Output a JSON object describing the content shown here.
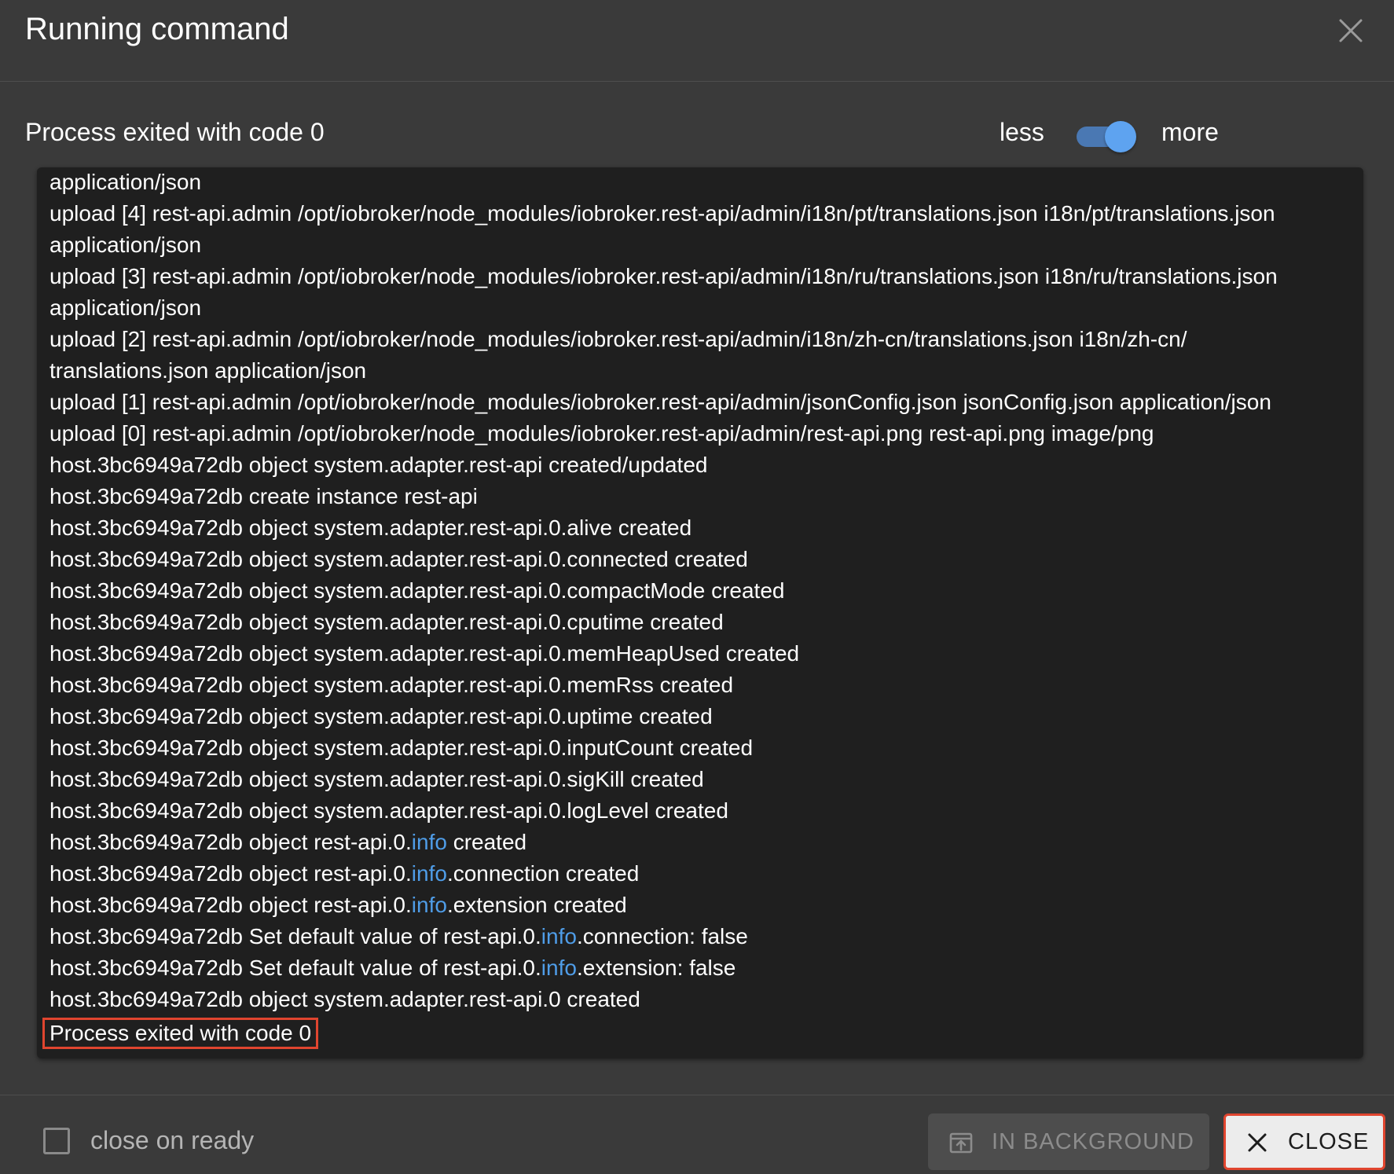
{
  "dialog": {
    "title": "Running command",
    "close_icon": "close-icon"
  },
  "status": {
    "text": "Process exited with code 0"
  },
  "verbosity_toggle": {
    "less_label": "less",
    "more_label": "more",
    "checked": true,
    "accent_color": "#5ea3f0"
  },
  "log": {
    "lines": [
      [
        {
          "t": "application/json"
        }
      ],
      [
        {
          "t": "upload [4] rest-api.admin /opt/iobroker/node_modules/iobroker.rest-api/admin/i18n/pt/translations.json i18n/pt/translations.json"
        }
      ],
      [
        {
          "t": "application/json"
        }
      ],
      [
        {
          "t": "upload [3] rest-api.admin /opt/iobroker/node_modules/iobroker.rest-api/admin/i18n/ru/translations.json i18n/ru/translations.json"
        }
      ],
      [
        {
          "t": "application/json"
        }
      ],
      [
        {
          "t": "upload [2] rest-api.admin /opt/iobroker/node_modules/iobroker.rest-api/admin/i18n/zh-cn/translations.json i18n/zh-cn/"
        }
      ],
      [
        {
          "t": "translations.json application/json"
        }
      ],
      [
        {
          "t": "upload [1] rest-api.admin /opt/iobroker/node_modules/iobroker.rest-api/admin/jsonConfig.json jsonConfig.json application/json"
        }
      ],
      [
        {
          "t": "upload [0] rest-api.admin /opt/iobroker/node_modules/iobroker.rest-api/admin/rest-api.png rest-api.png image/png"
        }
      ],
      [
        {
          "t": "host.3bc6949a72db object system.adapter.rest-api created/updated"
        }
      ],
      [
        {
          "t": "host.3bc6949a72db create instance rest-api"
        }
      ],
      [
        {
          "t": "host.3bc6949a72db object system.adapter.rest-api.0.alive created"
        }
      ],
      [
        {
          "t": "host.3bc6949a72db object system.adapter.rest-api.0.connected created"
        }
      ],
      [
        {
          "t": "host.3bc6949a72db object system.adapter.rest-api.0.compactMode created"
        }
      ],
      [
        {
          "t": "host.3bc6949a72db object system.adapter.rest-api.0.cputime created"
        }
      ],
      [
        {
          "t": "host.3bc6949a72db object system.adapter.rest-api.0.memHeapUsed created"
        }
      ],
      [
        {
          "t": "host.3bc6949a72db object system.adapter.rest-api.0.memRss created"
        }
      ],
      [
        {
          "t": "host.3bc6949a72db object system.adapter.rest-api.0.uptime created"
        }
      ],
      [
        {
          "t": "host.3bc6949a72db object system.adapter.rest-api.0.inputCount created"
        }
      ],
      [
        {
          "t": "host.3bc6949a72db object system.adapter.rest-api.0.sigKill created"
        }
      ],
      [
        {
          "t": "host.3bc6949a72db object system.adapter.rest-api.0.logLevel created"
        }
      ],
      [
        {
          "t": "host.3bc6949a72db object rest-api.0."
        },
        {
          "t": "info",
          "hl": true
        },
        {
          "t": " created"
        }
      ],
      [
        {
          "t": "host.3bc6949a72db object rest-api.0."
        },
        {
          "t": "info",
          "hl": true
        },
        {
          "t": ".connection created"
        }
      ],
      [
        {
          "t": "host.3bc6949a72db object rest-api.0."
        },
        {
          "t": "info",
          "hl": true
        },
        {
          "t": ".extension created"
        }
      ],
      [
        {
          "t": "host.3bc6949a72db Set default value of rest-api.0."
        },
        {
          "t": "info",
          "hl": true
        },
        {
          "t": ".connection: false"
        }
      ],
      [
        {
          "t": "host.3bc6949a72db Set default value of rest-api.0."
        },
        {
          "t": "info",
          "hl": true
        },
        {
          "t": ".extension: false"
        }
      ],
      [
        {
          "t": "host.3bc6949a72db object system.adapter.rest-api.0 created"
        }
      ]
    ],
    "final_line": "Process exited with code 0",
    "highlight_color": "#4f9de8",
    "annotation_color": "#e0452f"
  },
  "footer": {
    "close_on_ready_label": "close on ready",
    "close_on_ready_checked": false,
    "background_button_label": "IN BACKGROUND",
    "background_button_icon": "move-to-background-icon",
    "close_button_label": "CLOSE",
    "close_button_icon": "close-icon"
  }
}
